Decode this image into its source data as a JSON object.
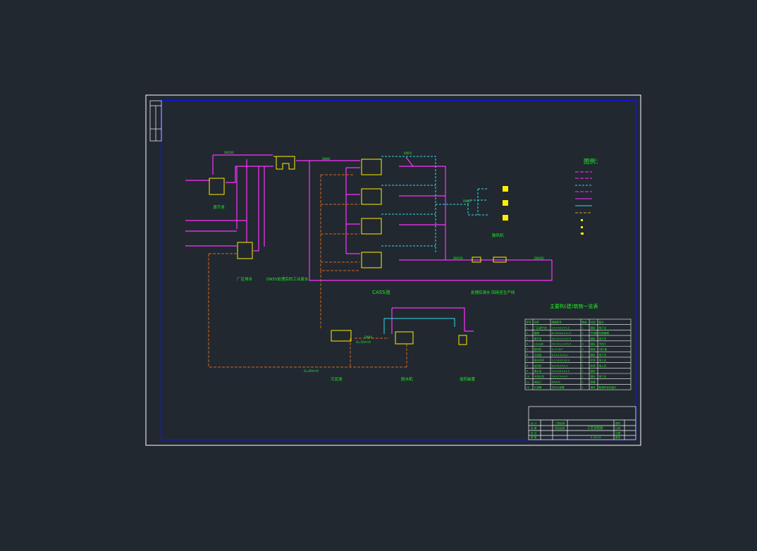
{
  "drawing": {
    "legend_title": "图例：",
    "labels": {
      "label_1": "调节池",
      "label_2": "厂区排水",
      "label_3": "DN55处理后的工业废水",
      "label_4": "CASS池",
      "label_5": "处理后清水   回用至生产线",
      "label_6": "污泥池",
      "label_7": "脱水机",
      "label_8": "加药装置",
      "label_9": "鼓风机",
      "label_10": "DN100",
      "label_11": "DN80",
      "label_12": "DN50",
      "label_13": "DN150",
      "label_14": "DN200",
      "label_15": "DN65",
      "label_16": "Q=40m³/h",
      "label_17": "Q=10m³/h",
      "label_18": "DN40"
    },
    "table_title": "主要构(建)筑物一览表",
    "table_headers": [
      "序号",
      "名称",
      "规格型号",
      "数量",
      "材质",
      "备注"
    ],
    "table_rows": [
      [
        "1",
        "厂区调节池",
        "15.0×8.0×5.0",
        "1",
        "钢砼",
        "地下式"
      ],
      [
        "2",
        "格栅",
        "B=500mm b=5",
        "1",
        "不锈钢",
        "机械格栅"
      ],
      [
        "3",
        "调节池",
        "20.0×10.0×5.5",
        "1",
        "钢砼",
        "地下式"
      ],
      [
        "4",
        "CASS池",
        "25.0×12.0×5.5",
        "4",
        "钢砼",
        "半地下"
      ],
      [
        "5",
        "鼓风机",
        "Q=5.0m³",
        "3",
        "碳钢",
        "2用1备"
      ],
      [
        "6",
        "污泥池",
        "6.0×4.0×4.0",
        "1",
        "钢砼",
        "地下式"
      ],
      [
        "7",
        "脱水机房",
        "12.0×8.0×6.0",
        "1",
        "砖混",
        "地上式"
      ],
      [
        "8",
        "加药间",
        "8.0×6.0×5.0",
        "1",
        "砖混",
        "地上式"
      ],
      [
        "9",
        "清水池",
        "10.0×8.0×4.5",
        "1",
        "钢砼",
        ""
      ],
      [
        "10",
        "中间水池",
        "5.0×5.0×4.0",
        "1",
        "钢砼",
        "地下式"
      ],
      [
        "11",
        "排放口",
        "DN300",
        "1",
        "钢管",
        ""
      ],
      [
        "12",
        "计量槽",
        "巴氏计量槽",
        "1",
        "钢砼",
        "配超声波流量计"
      ]
    ],
    "title_block": {
      "drawing_title": "工艺流程图",
      "drawing_no": "S-GS-04",
      "row_labels": [
        "设 计",
        "制 图",
        "校 对",
        "审 核"
      ],
      "cells": [
        "工程名称",
        "项目名称",
        "图号",
        "比例",
        "日期",
        "版本"
      ]
    }
  }
}
